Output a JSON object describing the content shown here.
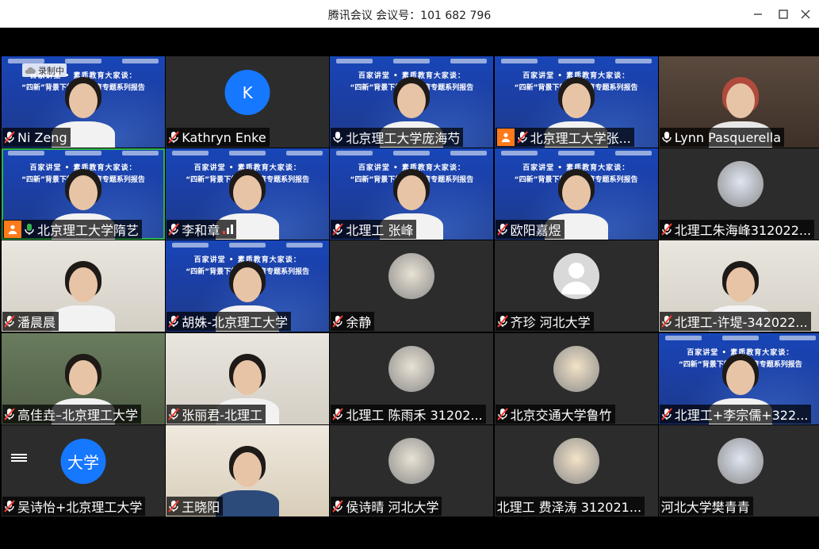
{
  "window": {
    "title": "腾讯会议 会议号：101 682 796"
  },
  "recording": {
    "label": "录制中"
  },
  "tiles": [
    {
      "name": "Ni Zeng",
      "kind": "slide-person",
      "mic": "muted"
    },
    {
      "name": "Kathryn Enke",
      "kind": "letter",
      "letter": "K",
      "color": "#1677ff",
      "mic": "muted"
    },
    {
      "name": "北京理工大学庞海芍",
      "kind": "slide-person",
      "mic": "active"
    },
    {
      "name": "北京理工大学张...",
      "kind": "slide-person",
      "mic": "muted",
      "host": true
    },
    {
      "name": "Lynn Pasquerella",
      "kind": "room",
      "mic": "active"
    },
    {
      "name": "北京理工大学隋艺",
      "kind": "slide-person",
      "mic": "speaking",
      "host": true
    },
    {
      "name": "李和章",
      "kind": "slide-person",
      "mic": "muted",
      "signal": true
    },
    {
      "name": "北理工 张峰",
      "kind": "slide-person",
      "mic": "muted"
    },
    {
      "name": "欧阳嘉煜",
      "kind": "slide-person",
      "mic": "muted"
    },
    {
      "name": "北理工朱海峰312022...",
      "kind": "avatar",
      "mic": "muted"
    },
    {
      "name": "潘晨晨",
      "kind": "wall-person",
      "mic": "muted"
    },
    {
      "name": "胡姝-北京理工大学",
      "kind": "slide-person",
      "mic": "muted"
    },
    {
      "name": "余静",
      "kind": "avatar",
      "mic": "muted"
    },
    {
      "name": "齐珍 河北大学",
      "kind": "avatar-blank",
      "mic": "muted"
    },
    {
      "name": "北理工-许堤-342022...",
      "kind": "wall-person",
      "mic": "muted"
    },
    {
      "name": "高佳垚–北京理工大学",
      "kind": "green-person",
      "mic": "muted"
    },
    {
      "name": "张丽君-北理工",
      "kind": "wall-person",
      "mic": "muted"
    },
    {
      "name": "北理工 陈雨禾 31202...",
      "kind": "avatar",
      "mic": "muted"
    },
    {
      "name": "北京交通大学鲁竹",
      "kind": "avatar",
      "mic": "muted"
    },
    {
      "name": "北理工+李宗儒+322...",
      "kind": "slide-person",
      "mic": "muted"
    },
    {
      "name": "吴诗怡+北京理工大学",
      "kind": "letter",
      "letter": "大学",
      "color": "#1677ff",
      "mic": "muted"
    },
    {
      "name": "王晓阳",
      "kind": "shelf-person",
      "mic": "muted"
    },
    {
      "name": "侯诗晴 河北大学",
      "kind": "avatar",
      "mic": "muted"
    },
    {
      "name": "北理工 费泽涛 312021...",
      "kind": "avatar",
      "mic": "none"
    },
    {
      "name": "河北大学樊青青",
      "kind": "avatar",
      "mic": "none"
    }
  ],
  "slide": {
    "line1": "百家讲堂 • 素质教育大家谈：",
    "line2": "“四新”背景下的素质教育专题系列报告"
  },
  "colors": {
    "muted_red": "#ff3b30",
    "active_green": "#2fb24a",
    "host_orange": "#ff7a1a"
  }
}
